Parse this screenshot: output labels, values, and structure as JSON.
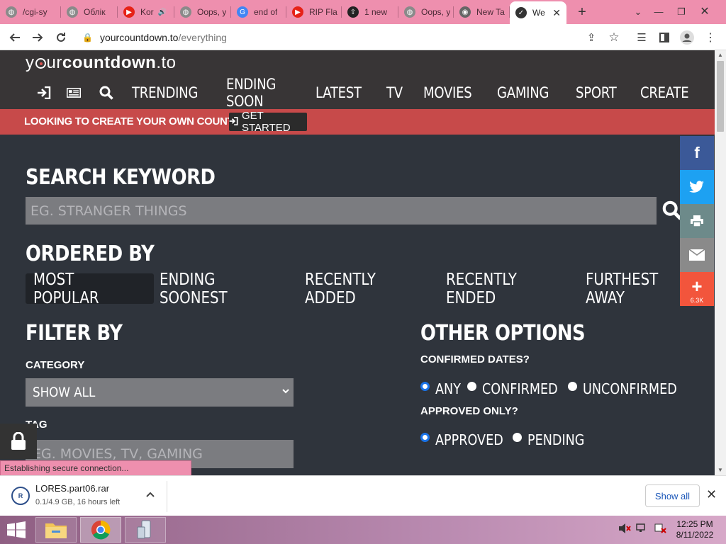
{
  "browser": {
    "tabs": [
      {
        "title": "/cgi-sy",
        "favicon": "globe-icon",
        "color": "#8a8a8a"
      },
      {
        "title": "Облік",
        "favicon": "globe-icon",
        "color": "#8a8a8a"
      },
      {
        "title": "Kor",
        "favicon": "youtube-icon",
        "color": "#e62117",
        "audio": true
      },
      {
        "title": "Oops, y",
        "favicon": "globe-icon",
        "color": "#8a8a8a"
      },
      {
        "title": "end of",
        "favicon": "google-icon",
        "color": "#4285f4"
      },
      {
        "title": "RIP Fla",
        "favicon": "youtube-icon",
        "color": "#e62117"
      },
      {
        "title": "1 new",
        "favicon": "upload-icon",
        "color": "#222222"
      },
      {
        "title": "Oops, y",
        "favicon": "globe-icon",
        "color": "#8a8a8a"
      },
      {
        "title": "New Ta",
        "favicon": "chrome-icon",
        "color": "#666666"
      },
      {
        "title": "We",
        "favicon": "countdown-icon",
        "color": "#333333",
        "active": true
      }
    ],
    "url_domain": "yourcountdown.to",
    "url_path": "/everything"
  },
  "site": {
    "logo_prefix": "y",
    "logo_mid": "ur",
    "logo_bold": "countdown",
    "logo_suffix": ".to",
    "nav": [
      "TRENDING",
      "ENDING SOON",
      "LATEST",
      "TV",
      "MOVIES",
      "GAMING",
      "SPORT",
      "CREATE"
    ],
    "banner_text": "LOOKING TO CREATE YOUR OWN COUNTDOWN?",
    "banner_button": "GET STARTED",
    "search_heading": "SEARCH KEYWORD",
    "search_placeholder": "EG. STRANGER THINGS",
    "ordered_heading": "ORDERED BY",
    "order_options": [
      "MOST POPULAR",
      "ENDING SOONEST",
      "RECENTLY ADDED",
      "RECENTLY ENDED",
      "FURTHEST AWAY"
    ],
    "order_selected": "MOST POPULAR",
    "filter_heading": "FILTER BY",
    "category_label": "CATEGORY",
    "category_value": "SHOW ALL",
    "tag_label": "TAG",
    "tag_placeholder": "EG. MOVIES, TV, GAMING",
    "other_heading": "OTHER OPTIONS",
    "confirmed_label": "CONFIRMED DATES?",
    "confirmed_options": [
      "ANY",
      "CONFIRMED",
      "UNCONFIRMED"
    ],
    "confirmed_selected": "ANY",
    "approved_label": "APPROVED ONLY?",
    "approved_options": [
      "APPROVED",
      "PENDING"
    ],
    "approved_selected": "APPROVED",
    "share_count": "6.3K",
    "colors": {
      "header_bg": "#383536",
      "banner_bg": "#c74a4a",
      "page_bg": "#2f343c",
      "facebook": "#3b5998",
      "twitter": "#1da1f2",
      "print": "#6d8a8a",
      "email": "#8a8a8a",
      "more": "#f2553c"
    }
  },
  "status_text": "Establishing secure connection...",
  "download": {
    "filename": "LORES.part06.rar",
    "progress": "0.1/4.9 GB, 16 hours left",
    "show_all": "Show all"
  },
  "taskbar": {
    "time": "12:25 PM",
    "date": "8/11/2022"
  }
}
